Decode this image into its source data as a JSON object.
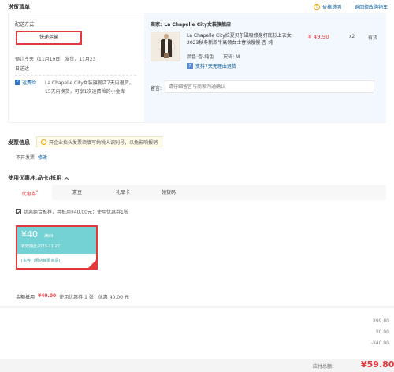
{
  "header": {
    "title": "送货清单",
    "price_link": "价格说明",
    "back_to_cart": "返回修改购物车"
  },
  "delivery": {
    "method_label": "配送方式",
    "method_selected": "快递运输",
    "estimate": "预计今天（11月19日）发货，11月23",
    "estimate_line2": "日送达",
    "guarantee_badge": "运费险",
    "guarantee_text": "La Chapelle City女装旗舰店7天内退货，15天内换货，可享1次运费险的小金库"
  },
  "store": {
    "label": "商家:",
    "name": "La Chapelle City女装旗舰店"
  },
  "product": {
    "title": "La Chapelle City拉夏贝尔磁吸修身打底衫上衣女2023秋冬新款半高领女士春秋慢慢 杏-纯",
    "price": "¥ 49.90",
    "qty": "x2",
    "stock": "有货",
    "color_label": "颜色:",
    "color_value": "杏-纯色",
    "size_label": "尺码:",
    "size_value": "M",
    "return_badge": "7",
    "return_text": "支持7天无理由退货"
  },
  "note": {
    "label": "留言:",
    "placeholder": "请仔细留言与商家沟通确认"
  },
  "invoice": {
    "title": "发票信息",
    "tip": "开企业抬头发票须填写纳税人识别号，以免影响报销",
    "status": "不开发票",
    "edit": "修改"
  },
  "coupons": {
    "title": "使用优惠/礼品卡/抵用",
    "tabs": [
      "优惠券",
      "京豆",
      "礼品卡",
      "领货码"
    ],
    "active_tab_marker": "*",
    "option_text": "优惠组合推荐，共抵用¥40.00元；使用优惠券1张",
    "card": {
      "amount": "¥40",
      "condition": "满99",
      "valid": "有效期至2023-11-22",
      "scope": "[东券] [限店铺限商品]"
    }
  },
  "summary": {
    "label": "金额抵用",
    "amount": "¥40.00",
    "detail": "使用优惠券 1 张，优惠 40.00 元"
  },
  "totals": {
    "values": [
      "¥99.80",
      "¥0.00",
      "-¥40.00"
    ],
    "payable_label": "应付总额:",
    "payable_amount": "¥59.80"
  },
  "colors": {
    "accent_red": "#e4393c",
    "link_blue": "#005aa0",
    "coupon_teal": "#74d2d4",
    "product_bg": "#f3f8fe"
  }
}
